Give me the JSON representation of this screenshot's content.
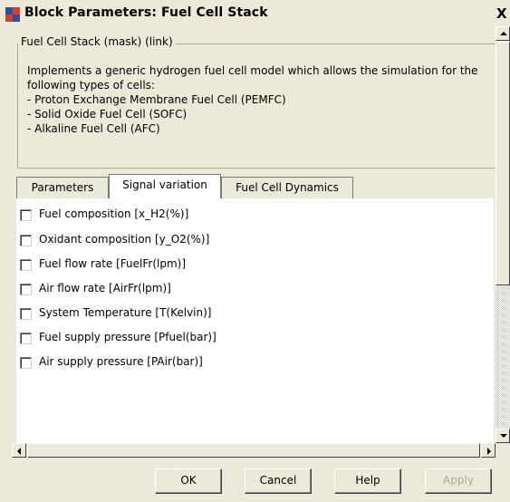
{
  "window": {
    "title": "Block Parameters: Fuel Cell Stack",
    "close_glyph": "X",
    "icon": "simulink-block-icon",
    "colors": {
      "background": "#ece9d8",
      "tab_active": "#ffffff",
      "disabled_text": "#aca899"
    }
  },
  "group": {
    "legend": "Fuel Cell Stack (mask) (link)",
    "description_lines": [
      "Implements a generic hydrogen fuel cell model which allows the simulation for the",
      "following types of cells:",
      "- Proton Exchange Membrane Fuel Cell (PEMFC)",
      "- Solid Oxide Fuel Cell (SOFC)",
      "- Alkaline Fuel Cell (AFC)"
    ]
  },
  "tabs": [
    {
      "label": "Parameters",
      "active": false
    },
    {
      "label": "Signal variation",
      "active": true
    },
    {
      "label": "Fuel Cell Dynamics",
      "active": false
    }
  ],
  "signal_variation": [
    {
      "label": "Fuel  composition [x_H2(%)]",
      "checked": false
    },
    {
      "label": "Oxidant composition [y_O2(%)]",
      "checked": false
    },
    {
      "label": "Fuel flow rate [FuelFr(lpm)]",
      "checked": false
    },
    {
      "label": "Air flow rate [AirFr(lpm)]",
      "checked": false
    },
    {
      "label": "System Temperature [T(Kelvin)]",
      "checked": false
    },
    {
      "label": "Fuel supply pressure [Pfuel(bar)]",
      "checked": false
    },
    {
      "label": "Air supply pressure [PAir(bar)]",
      "checked": false
    }
  ],
  "buttons": {
    "ok": "OK",
    "cancel": "Cancel",
    "help": "Help",
    "apply": "Apply",
    "apply_enabled": false
  }
}
